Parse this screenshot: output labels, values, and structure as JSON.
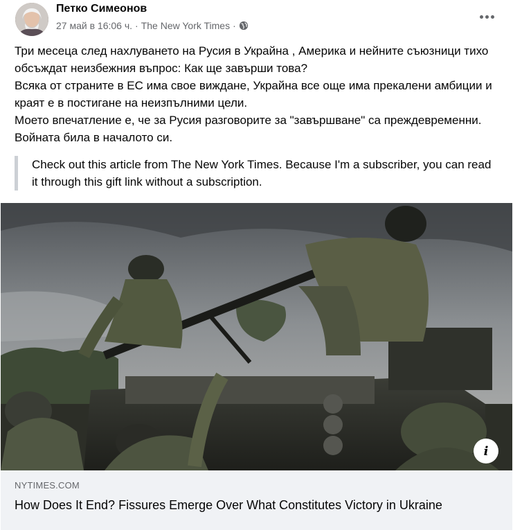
{
  "post": {
    "author": "Петко Симеонов",
    "timestamp": "27 май в 16:06 ч.",
    "separator": "·",
    "source": "The New York Times",
    "audience_icon": "globe-icon",
    "more_icon": "more-options-icon"
  },
  "body": {
    "paragraphs": [
      "Три месеца след нахлуването на Русия в Украйна , Америка и нейните съюзници тихо обсъждат неизбежния въпрос: Как ще завърши това?",
      "Всяка от страните в ЕС има свое виждане, Украйна все още има прекалени амбиции и краят е в постигане на неизпълними цели.",
      "Моето впечатление е, че за Русия разговорите за \"завършване\" са преждевременни. Войната била в началото си."
    ]
  },
  "quote": {
    "text": "Check out this article from The New York Times. Because I'm a subscriber, you can read it through this gift link without a subscription."
  },
  "link_preview": {
    "image_icon": "info-icon",
    "info_glyph": "i",
    "domain": "NYTIMES.COM",
    "title": "How Does It End? Fissures Emerge Over What Constitutes Victory in Ukraine"
  }
}
